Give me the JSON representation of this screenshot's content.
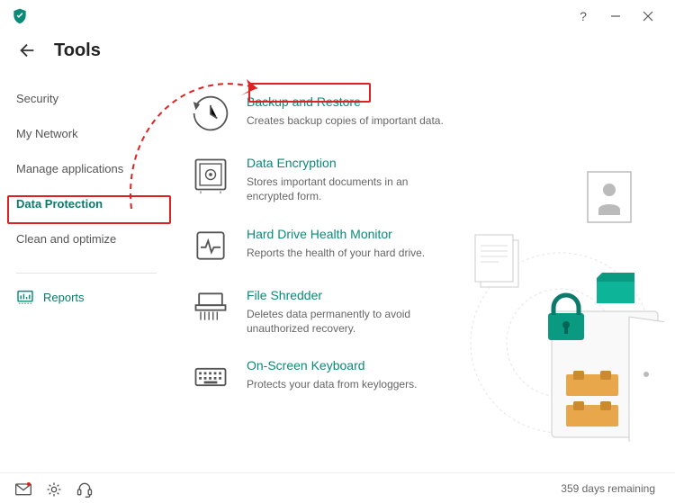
{
  "header": {
    "title": "Tools"
  },
  "sidebar": {
    "items": [
      {
        "label": "Security"
      },
      {
        "label": "My Network"
      },
      {
        "label": "Manage applications"
      },
      {
        "label": "Data Protection"
      },
      {
        "label": "Clean and optimize"
      }
    ],
    "reports_label": "Reports"
  },
  "tools": [
    {
      "title": "Backup and Restore",
      "desc": "Creates backup copies of important data."
    },
    {
      "title": "Data Encryption",
      "desc": "Stores important documents in an encrypted form."
    },
    {
      "title": "Hard Drive Health Monitor",
      "desc": "Reports the health of your hard drive."
    },
    {
      "title": "File Shredder",
      "desc": "Deletes data permanently to avoid unauthorized recovery."
    },
    {
      "title": "On-Screen Keyboard",
      "desc": "Protects your data from keyloggers."
    }
  ],
  "status": {
    "remaining": "359 days remaining"
  },
  "colors": {
    "accent": "#0a8a78",
    "highlight": "#d22"
  }
}
